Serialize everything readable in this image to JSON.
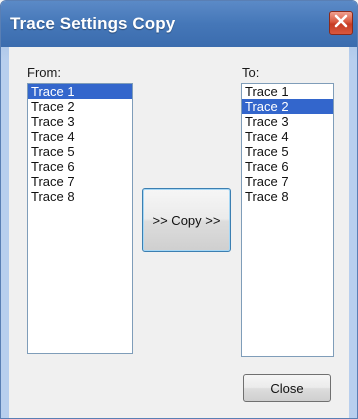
{
  "window": {
    "title": "Trace Settings Copy"
  },
  "from": {
    "label": "From:",
    "items": [
      "Trace 1",
      "Trace 2",
      "Trace 3",
      "Trace 4",
      "Trace 5",
      "Trace 6",
      "Trace 7",
      "Trace 8"
    ],
    "selected": "Trace 1"
  },
  "to": {
    "label": "To:",
    "items": [
      "Trace 1",
      "Trace 2",
      "Trace 3",
      "Trace 4",
      "Trace 5",
      "Trace 6",
      "Trace 7",
      "Trace 8"
    ],
    "selected": "Trace 2"
  },
  "buttons": {
    "copy_label": ">> Copy >>",
    "close_label": "Close"
  },
  "icons": {
    "window_close": "close-icon"
  },
  "colors": {
    "selection": "#3366cc",
    "title_bar": "#4577b8",
    "close_button": "#d9583e"
  }
}
